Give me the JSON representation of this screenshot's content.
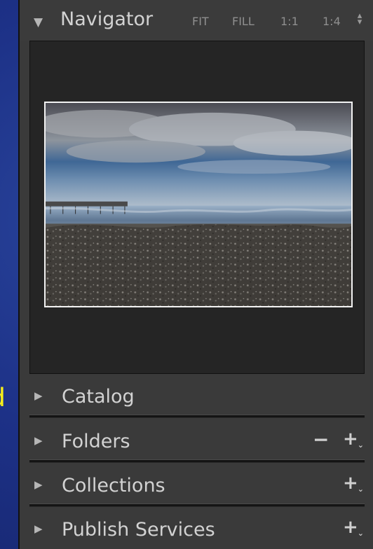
{
  "side_caption": "d",
  "navigator": {
    "title": "Navigator",
    "zoom_options": [
      {
        "label": "FIT"
      },
      {
        "label": "FILL"
      },
      {
        "label": "1:1"
      },
      {
        "label": "1:4"
      }
    ]
  },
  "sections": [
    {
      "title": "Catalog"
    },
    {
      "title": "Folders"
    },
    {
      "title": "Collections"
    },
    {
      "title": "Publish Services"
    }
  ],
  "icons": {
    "collapsed_triangle": "triangle-right-icon",
    "expanded_triangle": "triangle-down-icon",
    "zoom_stepper": "up-down-arrows-icon",
    "remove": "minus-icon",
    "add": "plus-icon"
  },
  "colors": {
    "background": "#1d3187",
    "panel": "#3a3a3a",
    "preview": "#252525",
    "text": "#d2d2d2",
    "caption": "#f7ef1a"
  }
}
